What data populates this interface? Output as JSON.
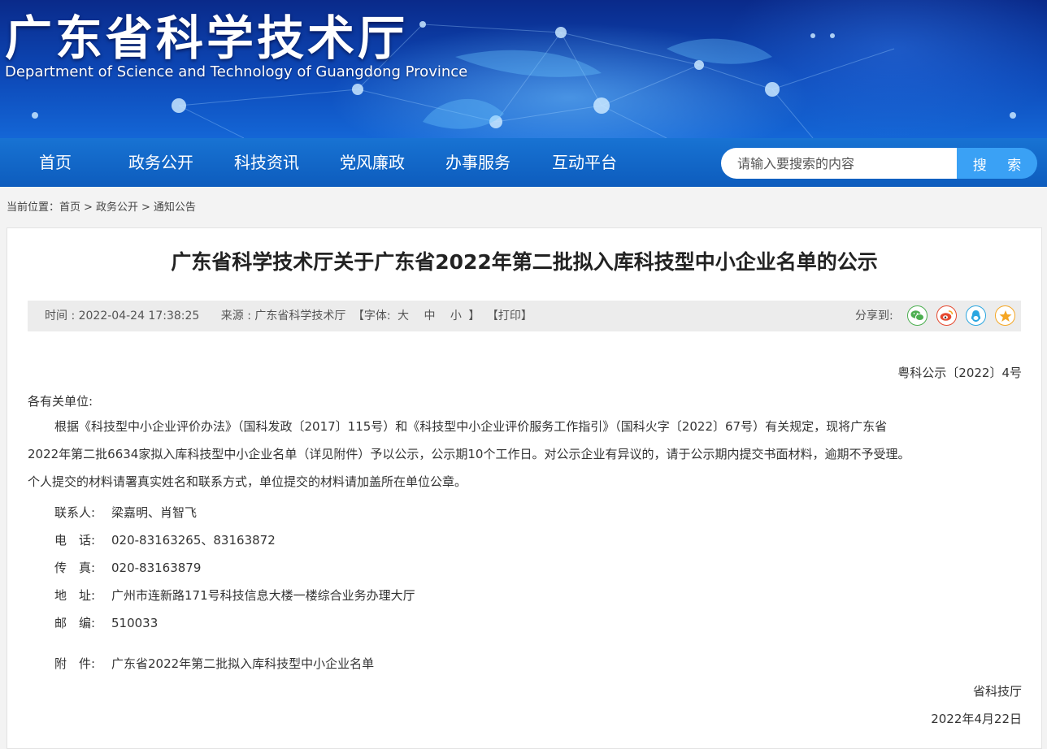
{
  "site": {
    "title": "广东省科学技术厅",
    "subtitle": "Department of Science and Technology of Guangdong Province"
  },
  "nav": {
    "items": [
      "首页",
      "政务公开",
      "科技资讯",
      "党风廉政",
      "办事服务",
      "互动平台"
    ]
  },
  "search": {
    "placeholder": "请输入要搜索的内容",
    "button_label": "搜 索"
  },
  "breadcrumb": {
    "prefix": "当前位置：",
    "items": [
      "首页",
      "政务公开",
      "通知公告"
    ],
    "separator": ">"
  },
  "article": {
    "title": "广东省科学技术厅关于广东省2022年第二批拟入库科技型中小企业名单的公示",
    "meta": {
      "time": "时间 : 2022-04-24 17:38:25",
      "source": "来源 : 广东省科学技术厅",
      "font_open": "【字体:",
      "font_large": "大",
      "font_medium": "中",
      "font_small": "小",
      "font_close": "】",
      "print": "【打印】",
      "share_label": "分享到:"
    },
    "share_icons": [
      {
        "name": "wechat-icon",
        "color": "#4caf50"
      },
      {
        "name": "weibo-icon",
        "color": "#e6492f"
      },
      {
        "name": "qq-icon",
        "color": "#2aa6e0"
      },
      {
        "name": "favorite-star-icon",
        "color": "#f5a623"
      }
    ],
    "doc_number": "粤科公示〔2022〕4号",
    "salutation": "各有关单位:",
    "body_lines": [
      "根据《科技型中小企业评价办法》（国科发政〔2017〕115号）和《科技型中小企业评价服务工作指引》（国科火字〔2022〕67号）有关规定，现将广东省",
      "2022年第二批6634家拟入库科技型中小企业名单（详见附件）予以公示，公示期10个工作日。对公示企业有异议的，请于公示期内提交书面材料，逾期不予受理。",
      "个人提交的材料请署真实姓名和联系方式，单位提交的材料请加盖所在单位公章。"
    ],
    "contacts": [
      {
        "label": "联系人:",
        "value": "梁嘉明、肖智飞"
      },
      {
        "label": "电　话:",
        "value": "020-83163265、83163872"
      },
      {
        "label": "传　真:",
        "value": "020-83163879"
      },
      {
        "label": "地　址:",
        "value": "广州市连新路171号科技信息大楼一楼综合业务办理大厅"
      },
      {
        "label": "邮　编:",
        "value": "510033"
      }
    ],
    "attachment": {
      "label": "附　件:",
      "value": "广东省2022年第二批拟入库科技型中小企业名单"
    },
    "signature": "省科技厅",
    "date": "2022年4月22日"
  }
}
